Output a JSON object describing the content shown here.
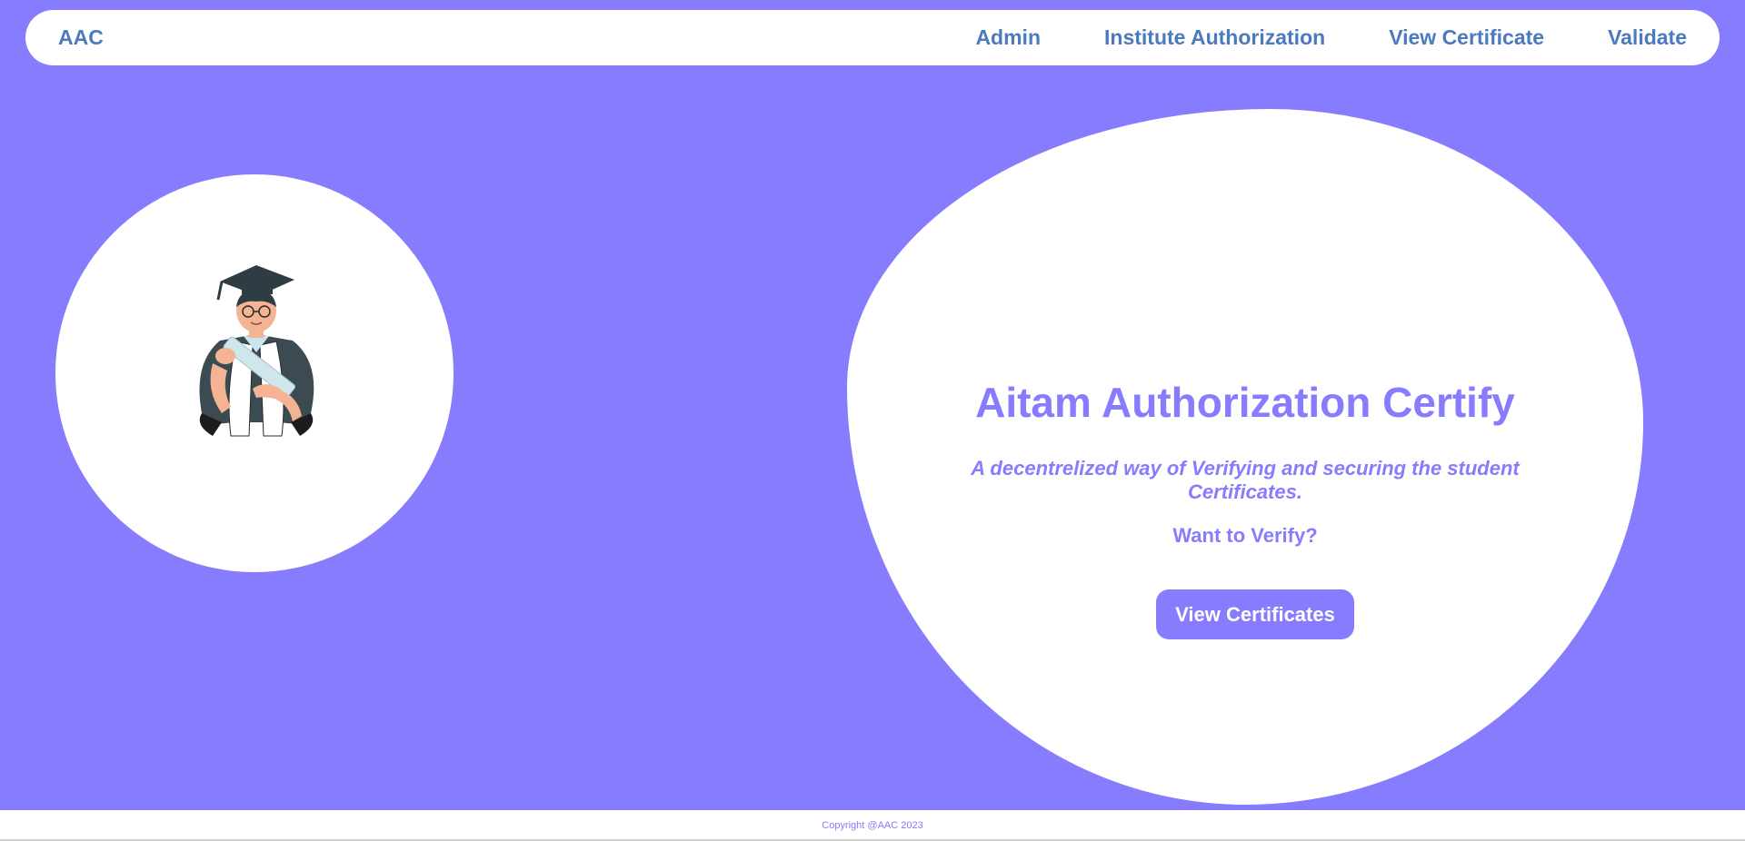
{
  "navbar": {
    "brand": "AAC",
    "links": [
      {
        "label": "Admin"
      },
      {
        "label": "Institute Authorization"
      },
      {
        "label": "View Certificate"
      },
      {
        "label": "Validate"
      }
    ]
  },
  "hero": {
    "title": "Aitam Authorization Certify",
    "subtitle": "A decentrelized way of Verifying and securing the student Certificates.",
    "question": "Want to Verify?",
    "cta_label": "View Certificates",
    "illustration_icon": "graduate-icon"
  },
  "footer": {
    "copyright": "Copyright @AAC 2023"
  },
  "colors": {
    "background": "#877bfe",
    "card": "#ffffff",
    "nav_text": "#4a7ac0",
    "accent": "#877bfe"
  }
}
